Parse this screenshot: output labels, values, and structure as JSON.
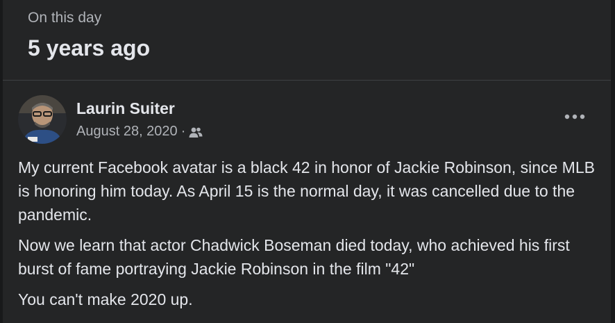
{
  "memory": {
    "label": "On this day",
    "years_ago": "5 years ago"
  },
  "post": {
    "author": "Laurin Suiter",
    "date": "August 28, 2020",
    "separator": "·",
    "audience_icon": "friends-icon",
    "more_icon": "more-options-icon",
    "paragraphs": [
      "My current Facebook avatar is a black 42 in honor of Jackie Robinson, since MLB is honoring him today. As April 15 is the normal day, it was cancelled due to the pandemic.",
      "Now we learn that actor Chadwick Boseman died today, who achieved his first burst of fame portraying Jackie Robinson in the film \"42\"",
      "You can't make 2020 up."
    ]
  },
  "colors": {
    "background": "#242526",
    "page": "#18191a",
    "primary_text": "#e4e6eb",
    "secondary_text": "#b0b3b8",
    "divider": "#3e4042"
  }
}
